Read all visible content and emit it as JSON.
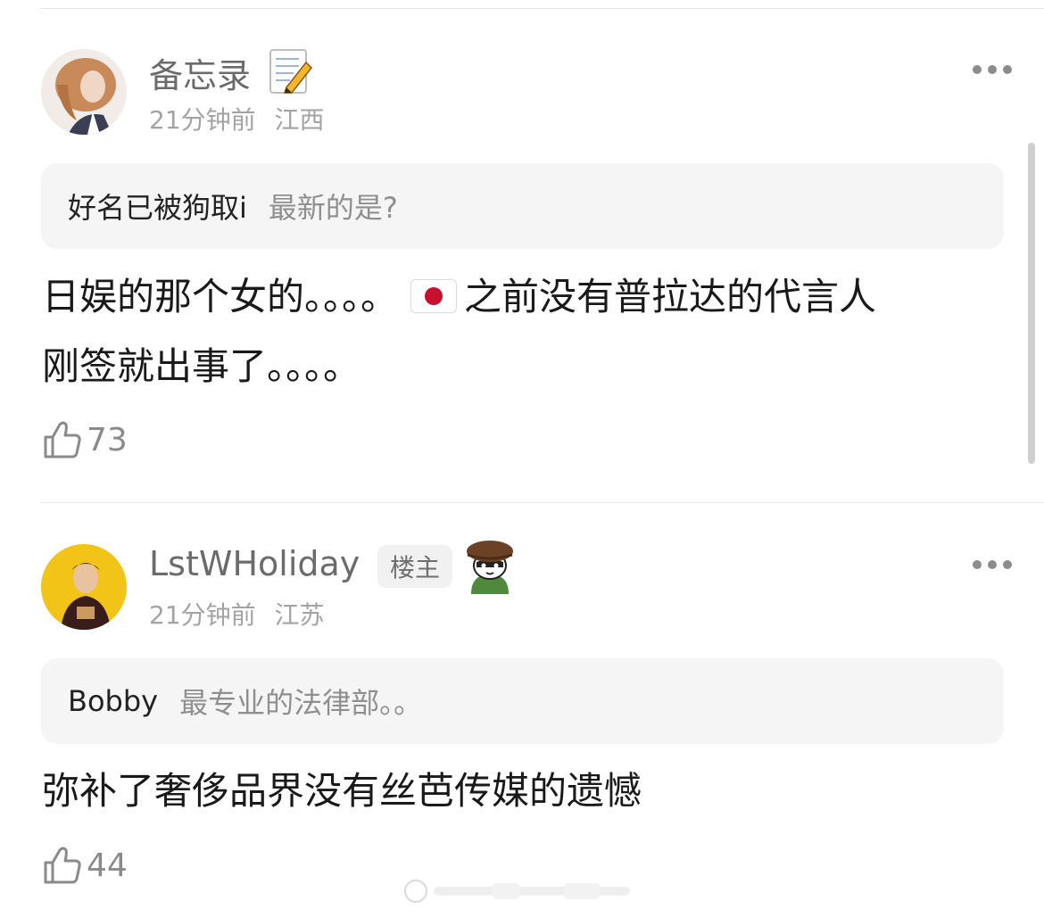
{
  "comments": [
    {
      "username": "备忘录",
      "time": "21分钟前",
      "location": "江西",
      "reply_to": {
        "user": "好名已被狗取i",
        "text": "最新的是?"
      },
      "body_line1_a": "日娱的那个女的。。。。",
      "body_line1_b": "之前没有普拉达的代言人",
      "body_line2": "刚签就出事了。。。。",
      "likes": "73",
      "emoji_icon": "memo-pencil-icon"
    },
    {
      "username": "LstWHoliday",
      "badge": "楼主",
      "time": "21分钟前",
      "location": "江苏",
      "reply_to": {
        "user": "Bobby",
        "text": "最专业的法律部。。"
      },
      "body": "弥补了奢侈品界没有丝芭传媒的遗憾",
      "likes": "44",
      "emoji_icon": "cat-with-hat-icon"
    }
  ],
  "colors": {
    "quote_bg": "#f5f5f5",
    "meta": "#a3a3a3",
    "username": "#6b6b6b"
  }
}
